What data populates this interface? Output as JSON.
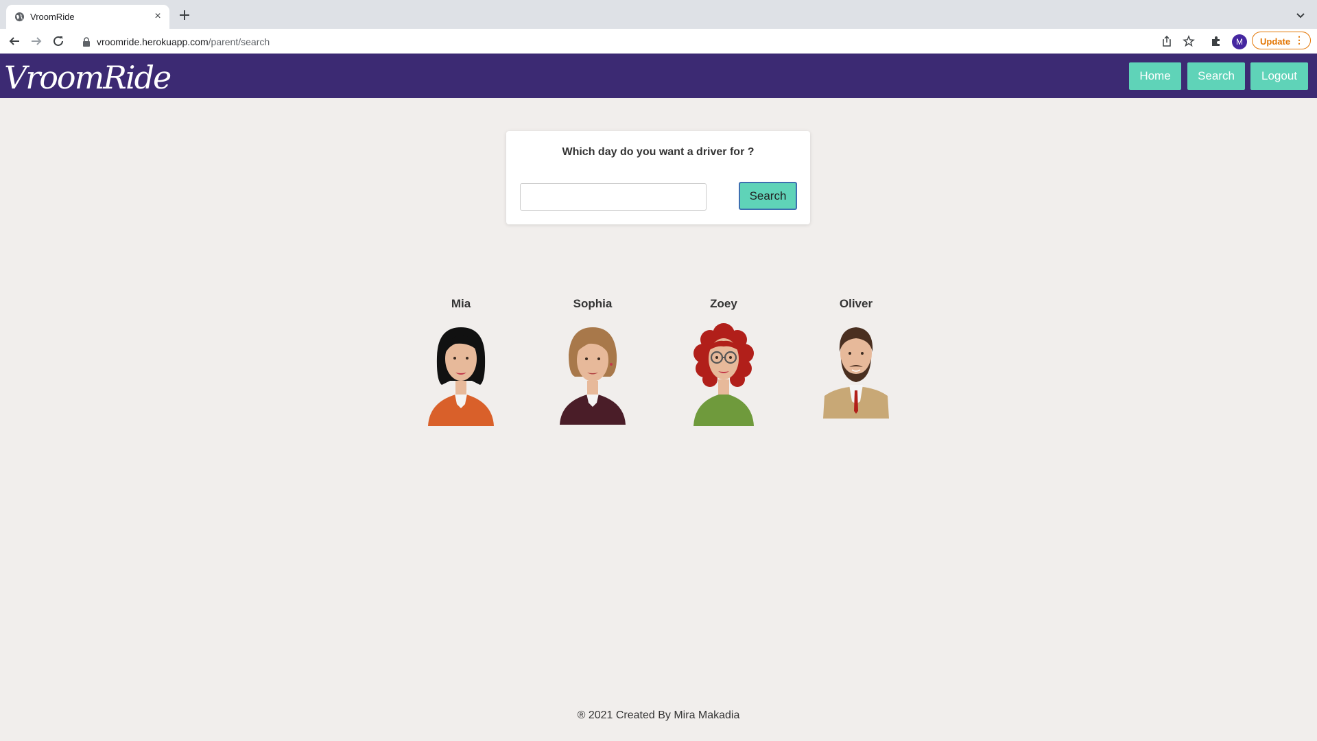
{
  "browser": {
    "tab_title": "VroomRide",
    "tab_close": "×",
    "url_host": "vroomride.herokuapp.com",
    "url_path": "/parent/search",
    "profile_initial": "M",
    "update_label": "Update",
    "menu_dots": "⋮"
  },
  "app": {
    "logo": "VroomRide",
    "nav": {
      "home": "Home",
      "search": "Search",
      "logout": "Logout"
    },
    "brand_color": "#3c2a73",
    "accent_color": "#5fd3b8"
  },
  "search_card": {
    "title": "Which day do you want a driver for ?",
    "input_value": "",
    "button_label": "Search"
  },
  "drivers": [
    {
      "name": "Mia"
    },
    {
      "name": "Sophia"
    },
    {
      "name": "Zoey"
    },
    {
      "name": "Oliver"
    }
  ],
  "footer": "® 2021 Created By Mira Makadia"
}
